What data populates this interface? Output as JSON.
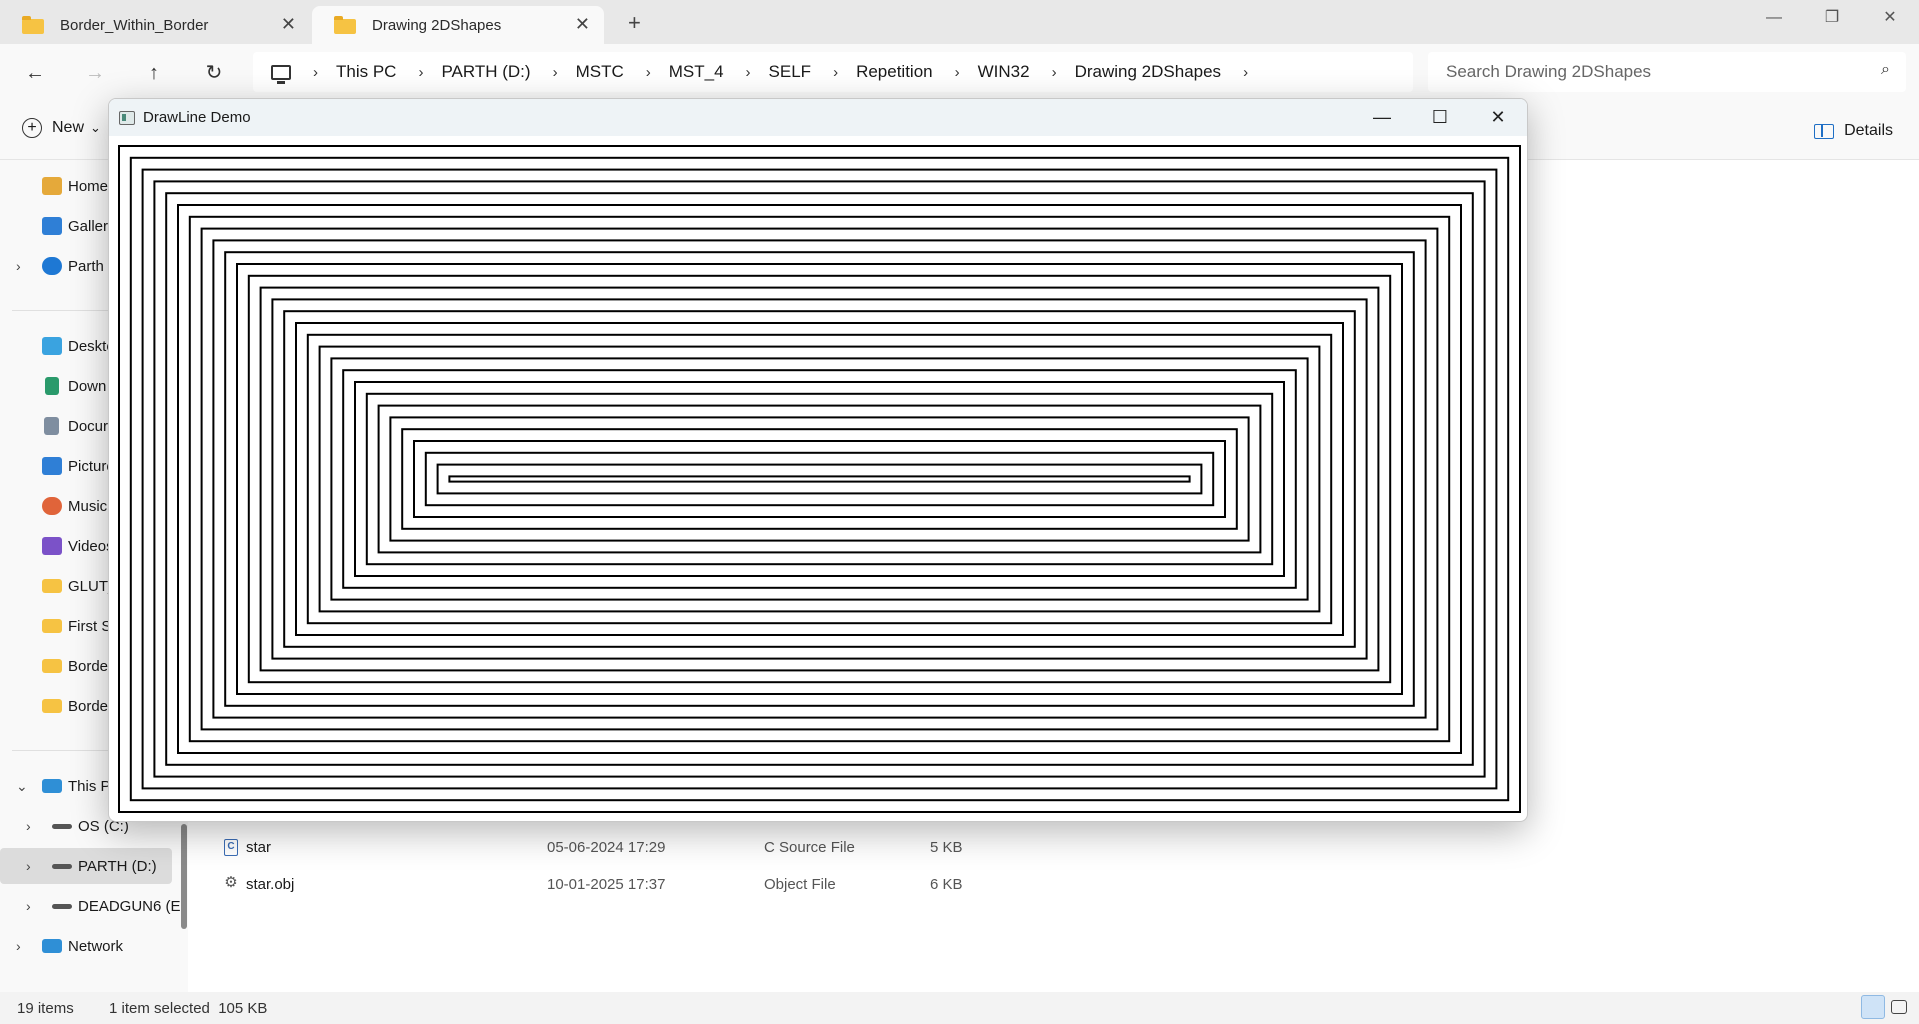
{
  "tabs": [
    {
      "label": "Border_Within_Border",
      "close": "✕"
    },
    {
      "label": "Drawing 2DShapes",
      "close": "✕"
    }
  ],
  "new_tab": "+",
  "window_controls": {
    "minimize": "—",
    "restore": "❐",
    "close": "✕"
  },
  "nav": {
    "back": "←",
    "forward": "→",
    "up": "↑",
    "refresh": "↻"
  },
  "breadcrumb": [
    "This PC",
    "PARTH (D:)",
    "MSTC",
    "MST_4",
    "SELF",
    "Repetition",
    "WIN32",
    "Drawing 2DShapes"
  ],
  "breadcrumb_sep": "›",
  "search": {
    "placeholder": "Search Drawing 2DShapes",
    "icon": "⌕"
  },
  "toolbar": {
    "new_label": "New",
    "new_caret": "⌄",
    "details_label": "Details"
  },
  "sidebar": {
    "items": [
      {
        "label": "Home",
        "icon": "home-icon",
        "color": "#e5a93a"
      },
      {
        "label": "Galler",
        "icon": "gallery-icon",
        "color": "#2f7fd6"
      },
      {
        "label": "Parth -",
        "icon": "onedrive-icon",
        "color": "#1e78d4"
      },
      {
        "label": "Deskto",
        "icon": "desktop-icon",
        "color": "#3aa3e0"
      },
      {
        "label": "Down",
        "icon": "download-icon",
        "color": "#2a9a6b"
      },
      {
        "label": "Docur",
        "icon": "documents-icon",
        "color": "#7f8ea0"
      },
      {
        "label": "Picture",
        "icon": "pictures-icon",
        "color": "#2f7fd6"
      },
      {
        "label": "Music",
        "icon": "music-icon",
        "color": "#e0643a"
      },
      {
        "label": "Videos",
        "icon": "videos-icon",
        "color": "#7b52c8"
      },
      {
        "label": "GLUT_",
        "icon": "folder-icon",
        "color": "#f6c343"
      },
      {
        "label": "First S",
        "icon": "folder-icon",
        "color": "#f6c343"
      },
      {
        "label": "Borde",
        "icon": "folder-icon",
        "color": "#f6c343"
      },
      {
        "label": "Borde",
        "icon": "folder-icon",
        "color": "#f6c343"
      },
      {
        "label": "This PC",
        "icon": "this-pc-icon",
        "color": "#2f8fd6"
      },
      {
        "label": "OS (C:)",
        "icon": "drive-icon",
        "color": "#555555"
      },
      {
        "label": "PARTH (D:)",
        "icon": "drive-icon",
        "color": "#555555"
      },
      {
        "label": "DEADGUN6 (E",
        "icon": "drive-icon",
        "color": "#555555"
      },
      {
        "label": "Network",
        "icon": "network-icon",
        "color": "#2f8fd6"
      }
    ],
    "chevron_right": "›",
    "chevron_down": "⌄"
  },
  "files": [
    {
      "name": "star",
      "date": "05-06-2024 17:29",
      "type": "C Source File",
      "size": "5 KB",
      "icon_glyph": "C"
    },
    {
      "name": "star.obj",
      "date": "10-01-2025 17:37",
      "type": "Object File",
      "size": "6 KB",
      "icon_glyph": "⚙"
    }
  ],
  "status": {
    "items": "19 items",
    "selected": "1 item selected  105 KB"
  },
  "drawline": {
    "title": "DrawLine Demo",
    "controls": {
      "minimize": "—",
      "maximize": "☐",
      "close": "✕"
    },
    "line_color": "#000000"
  }
}
